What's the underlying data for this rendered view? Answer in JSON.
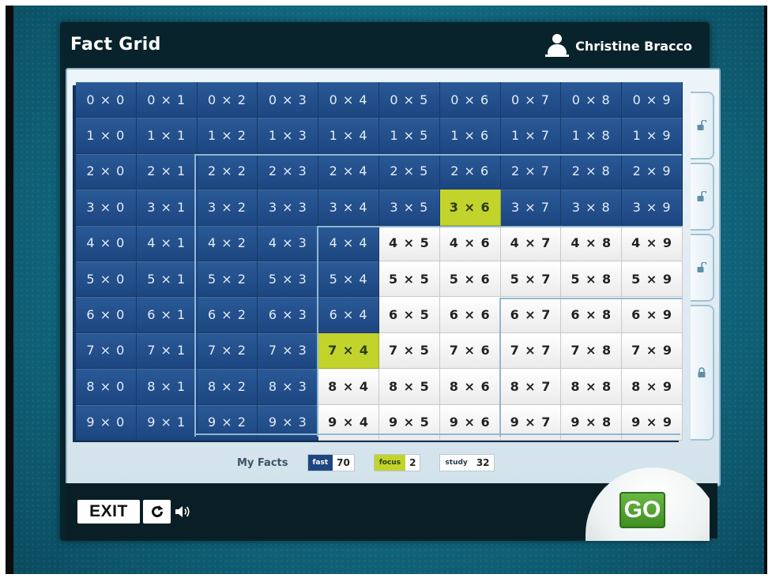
{
  "header": {
    "title": "Fact Grid",
    "user_name": "Christine Bracco"
  },
  "grid": {
    "operator": "×",
    "rows": [
      0,
      1,
      2,
      3,
      4,
      5,
      6,
      7,
      8,
      9
    ],
    "cols": [
      0,
      1,
      2,
      3,
      4,
      5,
      6,
      7,
      8,
      9
    ],
    "cell_status": [
      [
        "fast",
        "fast",
        "fast",
        "fast",
        "fast",
        "fast",
        "fast",
        "fast",
        "fast",
        "fast"
      ],
      [
        "fast",
        "fast",
        "fast",
        "fast",
        "fast",
        "fast",
        "fast",
        "fast",
        "fast",
        "fast"
      ],
      [
        "fast",
        "fast",
        "fast",
        "fast",
        "fast",
        "fast",
        "fast",
        "fast",
        "fast",
        "fast"
      ],
      [
        "fast",
        "fast",
        "fast",
        "fast",
        "fast",
        "fast",
        "focus",
        "fast",
        "fast",
        "fast"
      ],
      [
        "fast",
        "fast",
        "fast",
        "fast",
        "fast",
        "study",
        "study",
        "study",
        "study",
        "study"
      ],
      [
        "fast",
        "fast",
        "fast",
        "fast",
        "fast",
        "study",
        "study",
        "study",
        "study",
        "study"
      ],
      [
        "fast",
        "fast",
        "fast",
        "fast",
        "fast",
        "study",
        "study",
        "study",
        "study",
        "study"
      ],
      [
        "fast",
        "fast",
        "fast",
        "fast",
        "focus",
        "study",
        "study",
        "study",
        "study",
        "study"
      ],
      [
        "fast",
        "fast",
        "fast",
        "fast",
        "study",
        "study",
        "study",
        "study",
        "study",
        "study"
      ],
      [
        "fast",
        "fast",
        "fast",
        "fast",
        "study",
        "study",
        "study",
        "study",
        "study",
        "study"
      ]
    ]
  },
  "level_tabs": [
    {
      "state": "unlocked",
      "icon": "unlocked-padlock-icon"
    },
    {
      "state": "unlocked",
      "icon": "unlocked-padlock-icon"
    },
    {
      "state": "unlocked",
      "icon": "unlocked-padlock-icon"
    },
    {
      "state": "locked",
      "icon": "locked-padlock-icon"
    }
  ],
  "legend": {
    "label": "My Facts",
    "fast_label": "fast",
    "fast_count": "70",
    "focus_label": "focus",
    "focus_count": "2",
    "study_label": "study",
    "study_count": "32"
  },
  "controls": {
    "exit_label": "EXIT",
    "go_label": "GO"
  },
  "colors": {
    "fast": "#1d4680",
    "focus": "#c2d42b",
    "study": "#ffffff",
    "go": "#4fa22e",
    "background": "#137088"
  }
}
